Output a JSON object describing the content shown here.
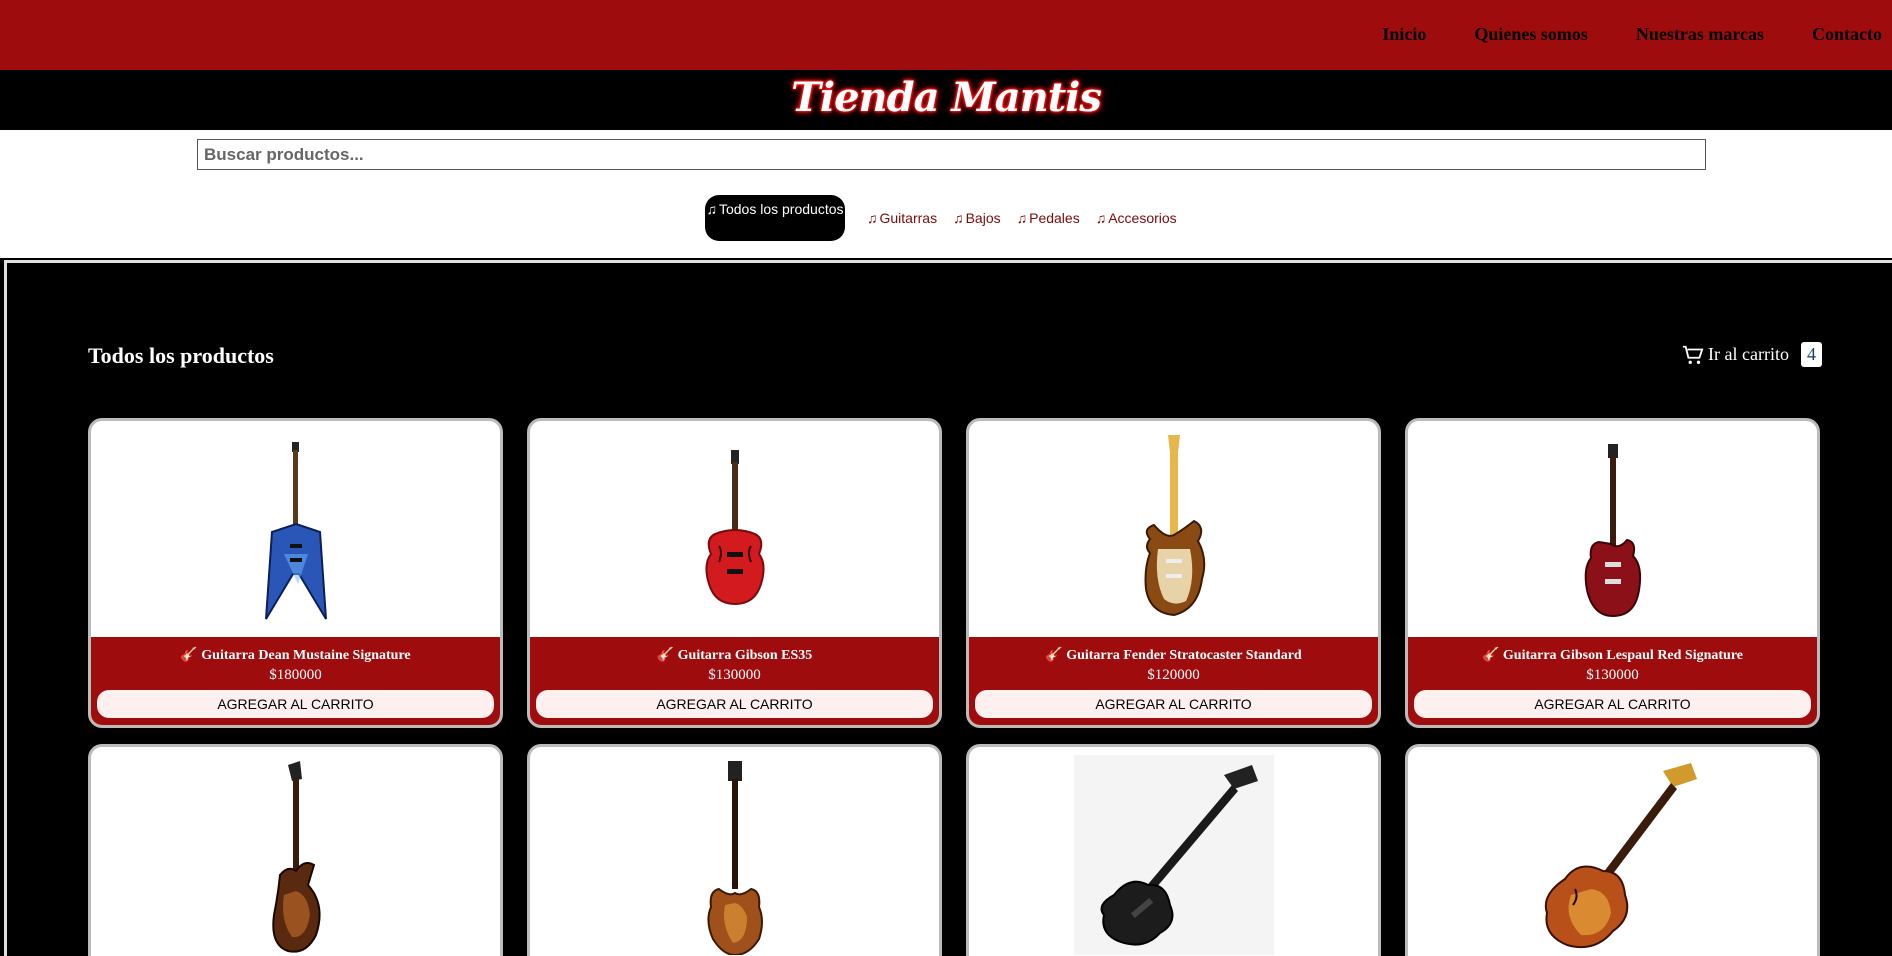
{
  "nav": {
    "links": [
      "Inicio",
      "Quienes somos",
      "Nuestras marcas",
      "Contacto"
    ]
  },
  "logo": {
    "text": "Tienda Mantis"
  },
  "search": {
    "placeholder": "Buscar productos...",
    "value": ""
  },
  "categories": {
    "active": "Todos los productos",
    "items": [
      "Guitarras",
      "Bajos",
      "Pedales",
      "Accesorios"
    ],
    "icon": "music-note-icon"
  },
  "main": {
    "title": "Todos los productos",
    "cart": {
      "label": "Ir al carrito",
      "count": "4",
      "icon": "cart-icon"
    }
  },
  "products": [
    {
      "name": "🎸 Guitarra Dean Mustaine Signature",
      "price": "$180000",
      "button": "AGREGAR AL CARRITO"
    },
    {
      "name": "🎸 Guitarra Gibson ES35",
      "price": "$130000",
      "button": "AGREGAR AL CARRITO"
    },
    {
      "name": "🎸 Guitarra Fender Stratocaster Standard",
      "price": "$120000",
      "button": "AGREGAR AL CARRITO"
    },
    {
      "name": "🎸 Guitarra Gibson Lespaul Red Signature",
      "price": "$130000",
      "button": "AGREGAR AL CARRITO"
    }
  ],
  "colors": {
    "brand_red": "#9e0c0e",
    "background": "#000000",
    "button_bg": "#fff0f0"
  }
}
